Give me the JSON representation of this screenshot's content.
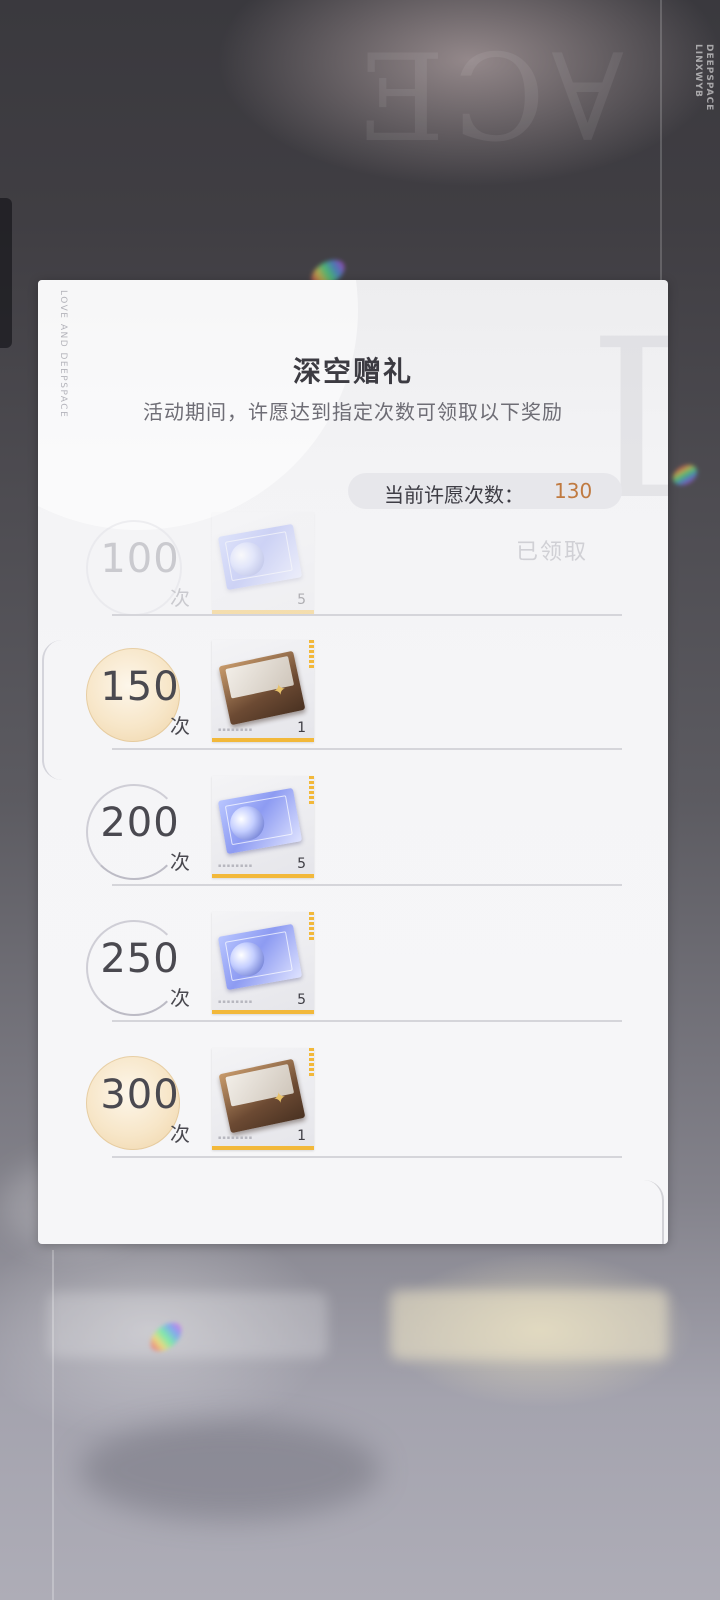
{
  "background": {
    "brand_text": "DEEPSPACE",
    "brand_subtext": "LINXWYB"
  },
  "panel": {
    "side_text": "LOVE AND DEEPSPACE",
    "title": "深空赠礼",
    "subtitle": "活动期间，许愿达到指定次数可领取以下奖励",
    "current_count_label": "当前许愿次数：",
    "current_count_value": "130"
  },
  "milestones": [
    {
      "count": "100",
      "unit": "次",
      "reward": "ticket",
      "quantity": "5",
      "status": "已领取"
    },
    {
      "count": "150",
      "unit": "次",
      "reward": "box",
      "quantity": "1",
      "status": ""
    },
    {
      "count": "200",
      "unit": "次",
      "reward": "ticket",
      "quantity": "5",
      "status": ""
    },
    {
      "count": "250",
      "unit": "次",
      "reward": "ticket",
      "quantity": "5",
      "status": ""
    },
    {
      "count": "300",
      "unit": "次",
      "reward": "box",
      "quantity": "1",
      "status": ""
    }
  ],
  "colors": {
    "accent_count": "#c07a40",
    "reward_bar": "#f2b83a",
    "gold_circle": "#f7e6c8"
  }
}
